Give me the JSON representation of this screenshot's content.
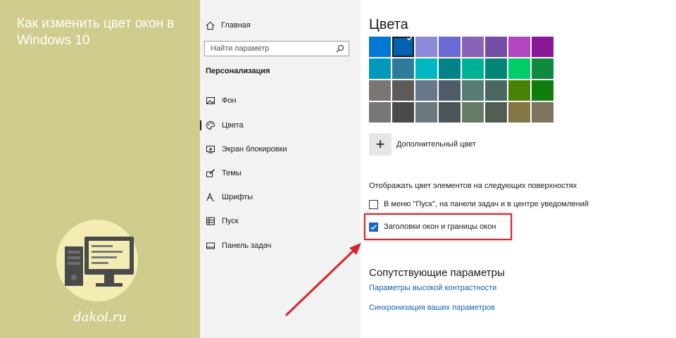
{
  "banner": {
    "title": "Как изменить цвет окон в Windows 10",
    "site": "dakol.ru",
    "logo_icon": "computer-desktop-icon",
    "background_color": "#cfcc8d"
  },
  "nav": {
    "home_label": "Главная",
    "home_icon": "home-icon",
    "search_placeholder": "Найти параметр",
    "search_icon": "search-icon",
    "section_title": "Персонализация",
    "items": [
      {
        "label": "Фон",
        "icon": "picture-icon"
      },
      {
        "label": "Цвета",
        "icon": "palette-icon",
        "active": true
      },
      {
        "label": "Экран блокировки",
        "icon": "lock-screen-icon"
      },
      {
        "label": "Темы",
        "icon": "brush-icon"
      },
      {
        "label": "Шрифты",
        "icon": "font-icon"
      },
      {
        "label": "Пуск",
        "icon": "start-icon"
      },
      {
        "label": "Панель задач",
        "icon": "taskbar-icon"
      }
    ]
  },
  "content": {
    "title": "Цвета",
    "swatch_rows": [
      [
        "#0078d7",
        "#0063b1",
        "#8e8cd8",
        "#6b69d6",
        "#8764b8",
        "#744da9",
        "#b146c2",
        "#881798"
      ],
      [
        "#0099bc",
        "#2d7d9a",
        "#00b7c3",
        "#038387",
        "#00b294",
        "#018574",
        "#00cc6a",
        "#10893e"
      ],
      [
        "#7a7574",
        "#5d5a58",
        "#68768a",
        "#515c6b",
        "#567c73",
        "#486860",
        "#498205",
        "#107c10"
      ],
      [
        "#767676",
        "#4c4a48",
        "#69797e",
        "#4a5459",
        "#647c64",
        "#525e54",
        "#847545",
        "#7e735f"
      ]
    ],
    "selected_swatch": "#0063b1",
    "custom_color_label": "Дополнительный цвет",
    "surfaces_heading": "Отображать цвет элементов на следующих поверхностях",
    "checkboxes": [
      {
        "label": "В меню \"Пуск\", на панели задач и в центре уведомлений",
        "checked": false
      },
      {
        "label": "Заголовки окон и границы окон",
        "checked": true
      }
    ],
    "related_heading": "Сопутствующие параметры",
    "links": [
      "Параметры высокой контрастности",
      "Синхронизация ваших параметров"
    ],
    "accent_color": "#1565c0",
    "highlight_color": "#d9222a"
  }
}
